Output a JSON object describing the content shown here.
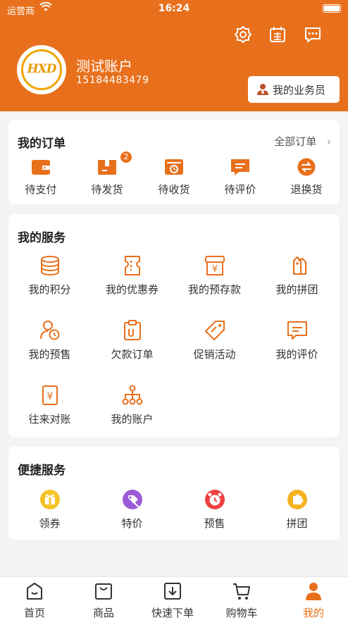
{
  "status_bar": {
    "carrier": "运营商",
    "time": "16:24"
  },
  "header": {
    "user_name": "测试账户",
    "phone": "15184483479",
    "avatar_logo": "HXD",
    "sales_button": "我的业务员",
    "icons": [
      "settings-icon",
      "sign-in-icon",
      "message-icon"
    ]
  },
  "orders": {
    "title": "我的订单",
    "all_orders": "全部订单",
    "items": [
      {
        "label": "待支付",
        "icon": "wallet-icon"
      },
      {
        "label": "待发货",
        "icon": "box-icon",
        "badge": "2"
      },
      {
        "label": "待收货",
        "icon": "clock-box-icon"
      },
      {
        "label": "待评价",
        "icon": "comment-icon"
      },
      {
        "label": "退换货",
        "icon": "exchange-icon"
      }
    ]
  },
  "services": {
    "title": "我的服务",
    "items": [
      {
        "label": "我的积分",
        "icon": "coins-icon"
      },
      {
        "label": "我的优惠券",
        "icon": "coupon-icon"
      },
      {
        "label": "我的预存款",
        "icon": "yen-deposit-icon"
      },
      {
        "label": "我的拼团",
        "icon": "tag-group-icon"
      },
      {
        "label": "我的预售",
        "icon": "user-clock-icon"
      },
      {
        "label": "欠款订单",
        "icon": "clipboard-icon"
      },
      {
        "label": "促销活动",
        "icon": "price-tag-icon"
      },
      {
        "label": "我的评价",
        "icon": "review-icon"
      },
      {
        "label": "往来对账",
        "icon": "yen-ledger-icon"
      },
      {
        "label": "我的账户",
        "icon": "account-tree-icon"
      }
    ]
  },
  "quick": {
    "title": "便捷服务",
    "items": [
      {
        "label": "领券",
        "icon": "coupon-gift-icon",
        "color": "#f5c326"
      },
      {
        "label": "特价",
        "icon": "special-price-icon",
        "color": "#9c5ad6"
      },
      {
        "label": "预售",
        "icon": "presale-clock-icon",
        "color": "#ee4040"
      },
      {
        "label": "拼团",
        "icon": "puzzle-icon",
        "color": "#f5b221"
      }
    ]
  },
  "tabbar": {
    "items": [
      {
        "label": "首页",
        "icon": "home-icon"
      },
      {
        "label": "商品",
        "icon": "bag-icon"
      },
      {
        "label": "快速下单",
        "icon": "download-box-icon"
      },
      {
        "label": "购物车",
        "icon": "cart-icon"
      },
      {
        "label": "我的",
        "icon": "person-icon",
        "active": true
      }
    ]
  },
  "colors": {
    "accent": "#e8701c",
    "background": "#f4f4f4"
  }
}
